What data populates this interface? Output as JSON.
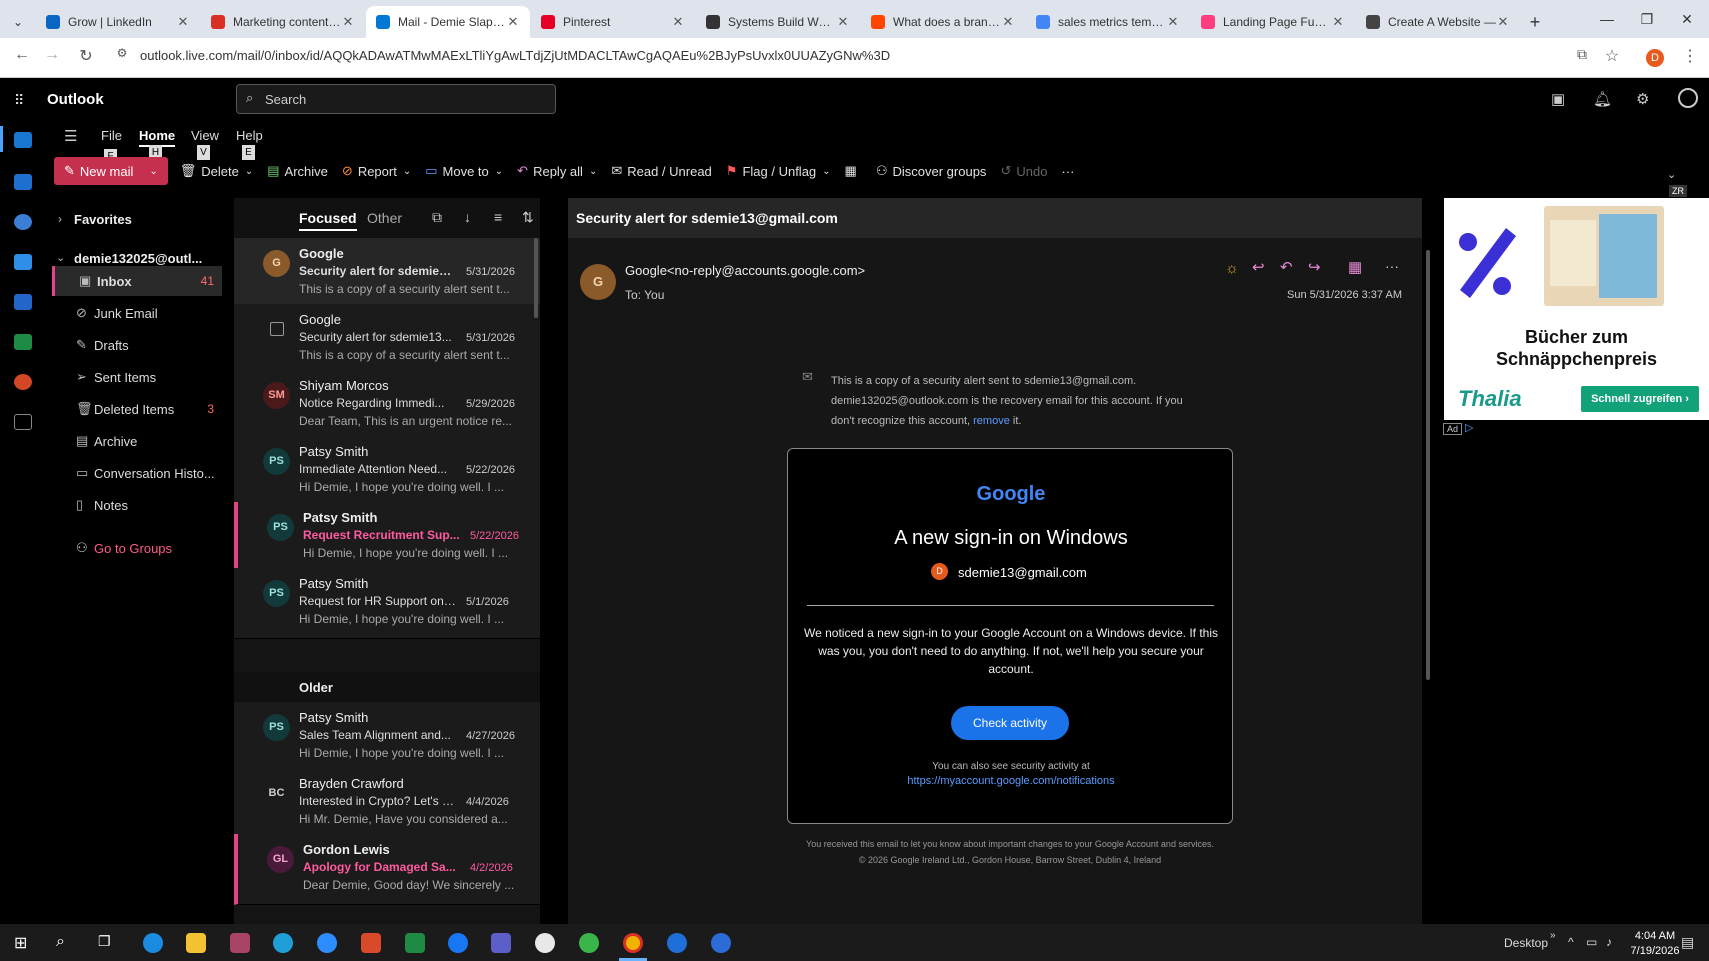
{
  "browser": {
    "tabs": [
      {
        "title": "Grow | LinkedIn",
        "color": "#0a66c2"
      },
      {
        "title": "Marketing content ap",
        "color": "#d93025"
      },
      {
        "title": "Mail - Demie Slappe",
        "color": "#0078d4",
        "active": true
      },
      {
        "title": "Pinterest",
        "color": "#e60023"
      },
      {
        "title": "Systems Build Wealth",
        "color": "#333333"
      },
      {
        "title": "What does a brand st",
        "color": "#ff4500"
      },
      {
        "title": "sales metrics templat",
        "color": "#4285f4"
      },
      {
        "title": "Landing Page Funnel",
        "color": "#ff3d7f"
      },
      {
        "title": "Create A Website —",
        "color": "#444444"
      }
    ],
    "url": "outlook.live.com/mail/0/inbox/id/AQQkADAwATMwMAExLTliYgAwLTdjZjUtMDACLTAwCgAQAEu%2BJyPsUvxlx0UUAZyGNw%3D",
    "profile_initial": "D"
  },
  "app": {
    "name": "Outlook",
    "search_placeholder": "Search",
    "menu": [
      "File",
      "Home",
      "View",
      "Help"
    ],
    "menu_keys": [
      "F",
      "H",
      "V",
      "E"
    ],
    "active_menu": "Home"
  },
  "ribbon": {
    "new_mail": "New mail",
    "delete": "Delete",
    "archive": "Archive",
    "report": "Report",
    "move_to": "Move to",
    "reply_all": "Reply all",
    "read_unread": "Read / Unread",
    "flag": "Flag / Unflag",
    "discover": "Discover groups",
    "undo": "Undo"
  },
  "folders": {
    "favorites": "Favorites",
    "account": "demie132025@outl...",
    "items": [
      {
        "label": "Inbox",
        "count": "41",
        "icon": "inbox-icon"
      },
      {
        "label": "Junk Email",
        "count": "",
        "icon": "junk-icon"
      },
      {
        "label": "Drafts",
        "count": "",
        "icon": "pencil-icon"
      },
      {
        "label": "Sent Items",
        "count": "",
        "icon": "send-icon"
      },
      {
        "label": "Deleted Items",
        "count": "3",
        "icon": "trash-icon"
      },
      {
        "label": "Archive",
        "count": "",
        "icon": "archive-icon"
      },
      {
        "label": "Conversation Histo...",
        "count": "",
        "icon": "folder-icon"
      },
      {
        "label": "Notes",
        "count": "",
        "icon": "note-icon"
      }
    ],
    "groups_link": "Go to Groups"
  },
  "list": {
    "tab_focused": "Focused",
    "tab_other": "Other",
    "older_label": "Older",
    "messages": [
      {
        "initials": "G",
        "sender": "Google",
        "subject": "Security alert for sdemie13...",
        "date": "5/31/2026",
        "preview": "This is a copy of a security alert sent t...",
        "av_bg": "#8a5a2b",
        "av_fg": "#f5d5b0"
      },
      {
        "initials": "",
        "sender": "Google",
        "subject": "Security alert for sdemie13...",
        "date": "5/31/2026",
        "preview": "This is a copy of a security alert sent t...",
        "av_bg": "transparent",
        "av_fg": "#ccc"
      },
      {
        "initials": "SM",
        "sender": "Shiyam Morcos",
        "subject": "Notice Regarding Immedi...",
        "date": "5/29/2026",
        "preview": "Dear Team, This is an urgent notice re...",
        "av_bg": "#4a1a1a",
        "av_fg": "#ff9a9a"
      },
      {
        "initials": "PS",
        "sender": "Patsy Smith",
        "subject": "Immediate Attention Need...",
        "date": "5/22/2026",
        "preview": "Hi Demie, I hope you're doing well. I ...",
        "av_bg": "#123a3a",
        "av_fg": "#9de0e0"
      },
      {
        "initials": "PS",
        "sender": "Patsy Smith",
        "subject": "Request Recruitment Sup...",
        "date": "5/22/2026",
        "preview": "Hi Demie, I hope you're doing well. I ...",
        "av_bg": "#123a3a",
        "av_fg": "#9de0e0"
      },
      {
        "initials": "PS",
        "sender": "Patsy Smith",
        "subject": "Request for HR Support on ...",
        "date": "5/1/2026",
        "preview": "Hi Demie, I hope you're doing well. I ...",
        "av_bg": "#123a3a",
        "av_fg": "#9de0e0"
      },
      {
        "initials": "PS",
        "sender": "Patsy Smith",
        "subject": "Sales Team Alignment and...",
        "date": "4/27/2026",
        "preview": "Hi Demie, I hope you're doing well. I ...",
        "av_bg": "#123a3a",
        "av_fg": "#9de0e0"
      },
      {
        "initials": "BC",
        "sender": "Brayden Crawford",
        "subject": "Interested in Crypto? Let's E...",
        "date": "4/4/2026",
        "preview": "Hi Mr. Demie, Have you considered a...",
        "av_bg": "#1b1b1b",
        "av_fg": "#ccc"
      },
      {
        "initials": "GL",
        "sender": "Gordon Lewis",
        "subject": "Apology for Damaged Sa...",
        "date": "4/2/2026",
        "preview": "Dear Demie, Good day! We sincerely ...",
        "av_bg": "#4a1a3a",
        "av_fg": "#f5a0d0"
      }
    ]
  },
  "reading": {
    "subject": "Security alert for sdemie13@gmail.com",
    "avatar": "G",
    "from": "Google<no-reply@accounts.google.com>",
    "to": "To:  You",
    "datetime": "Sun 5/31/2026 3:37 AM",
    "notice_1": "This is a copy of a security alert sent to sdemie13@gmail.com.",
    "notice_2": "demie132025@outlook.com is the recovery email for this account. If you",
    "notice_3": "don't recognize this account,",
    "notice_link": "remove",
    "notice_end": "it.",
    "card_logo": "Google",
    "card_title": "A new sign-in on Windows",
    "card_account_initial": "D",
    "card_account": "sdemie13@gmail.com",
    "card_body": "We noticed a new sign-in to your Google Account on a Windows device. If this was you, you don't need to do anything. If not, we'll help you secure your account.",
    "card_button": "Check activity",
    "card_also": "You can also see security activity at",
    "card_link": "https://myaccount.google.com/notifications",
    "footer_1": "You received this email to let you know about important changes to your Google Account and services.",
    "footer_2": "© 2026 Google Ireland Ltd., Gordon House, Barrow Street, Dublin 4, Ireland"
  },
  "ad": {
    "zr": "ZR",
    "headline_1": "Bücher zum",
    "headline_2": "Schnäppchenpreis",
    "brand": "Thalia",
    "cta": "Schnell zugreifen ›",
    "ad_label": "Ad"
  },
  "taskbar": {
    "desktop": "Desktop",
    "time": "4:04 AM",
    "date": "7/19/2026"
  }
}
